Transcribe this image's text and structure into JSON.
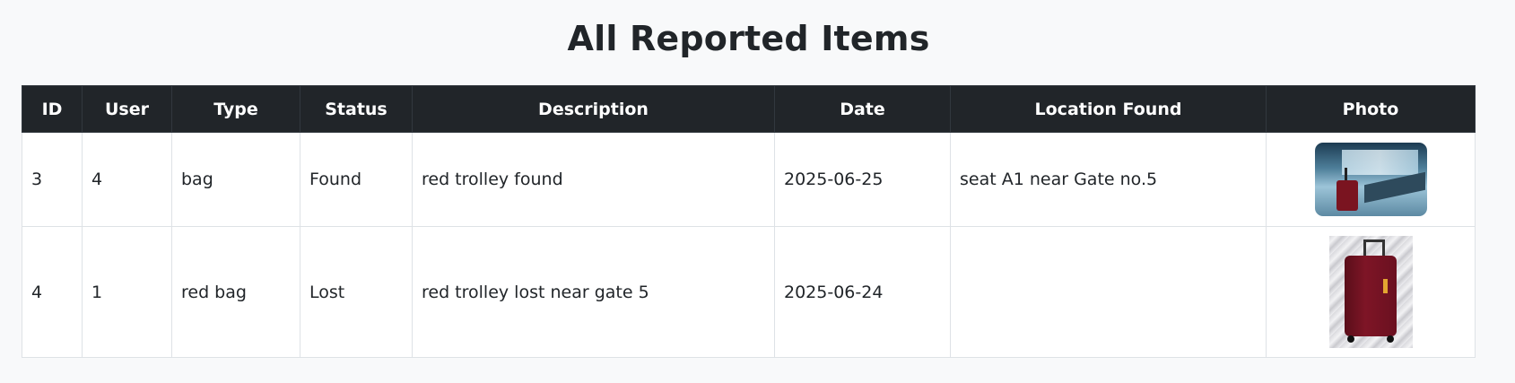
{
  "page": {
    "title": "All Reported Items"
  },
  "table": {
    "headers": [
      "ID",
      "User",
      "Type",
      "Status",
      "Description",
      "Date",
      "Location Found",
      "Photo"
    ],
    "rows": [
      {
        "id": "3",
        "user": "4",
        "type": "bag",
        "status": "Found",
        "description": "red trolley found",
        "date": "2025-06-25",
        "location_found": "seat A1 near Gate no.5",
        "photo": "red trolley beside airport seats"
      },
      {
        "id": "4",
        "user": "1",
        "type": "red bag",
        "status": "Lost",
        "description": "red trolley lost near gate 5",
        "date": "2025-06-24",
        "location_found": "",
        "photo": "red trolley suitcase"
      }
    ]
  }
}
